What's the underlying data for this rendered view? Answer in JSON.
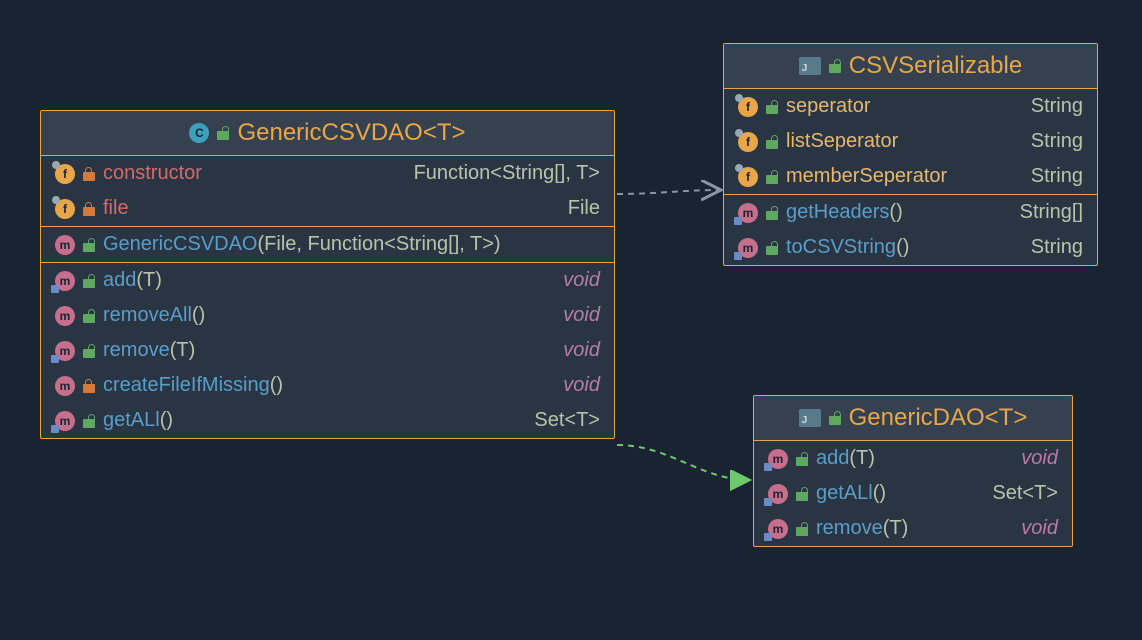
{
  "classes": {
    "generic_csv_dao": {
      "title": "GenericCSVDAO<T>",
      "fields": [
        {
          "icon": "f",
          "pin": true,
          "lock": "orange",
          "name": "constructor",
          "nameColor": "red",
          "type": "Function<String[], T>"
        },
        {
          "icon": "f",
          "pin": true,
          "lock": "orange",
          "name": "file",
          "nameColor": "red",
          "type": "File"
        }
      ],
      "constructors": [
        {
          "icon": "m",
          "lock": "green",
          "name": "GenericCSVDAO",
          "params": "(File, Function<String[], T>)"
        }
      ],
      "methods": [
        {
          "icon": "m",
          "lock": "green",
          "override": true,
          "name": "add",
          "params": "(T)",
          "ret": "void",
          "retStyle": "void"
        },
        {
          "icon": "m",
          "lock": "green",
          "name": "removeAll",
          "params": "()",
          "ret": "void",
          "retStyle": "void"
        },
        {
          "icon": "m",
          "lock": "green",
          "override": true,
          "name": "remove",
          "params": "(T)",
          "ret": "void",
          "retStyle": "void"
        },
        {
          "icon": "m",
          "lock": "orange",
          "name": "createFileIfMissing",
          "params": "()",
          "ret": "void",
          "retStyle": "void"
        },
        {
          "icon": "m",
          "lock": "green",
          "override": true,
          "name": "getALl",
          "params": "()",
          "ret": "Set<T>",
          "retStyle": "type"
        }
      ]
    },
    "csv_serializable": {
      "title": "CSVSerializable",
      "fields": [
        {
          "icon": "f",
          "pin": true,
          "lock": "green",
          "name": "seperator",
          "nameColor": "yellow",
          "type": "String"
        },
        {
          "icon": "f",
          "pin": true,
          "lock": "green",
          "name": "listSeperator",
          "nameColor": "yellow",
          "type": "String"
        },
        {
          "icon": "f",
          "pin": true,
          "lock": "green",
          "name": "memberSeperator",
          "nameColor": "yellow",
          "type": "String"
        }
      ],
      "methods": [
        {
          "icon": "m",
          "lock": "green",
          "override": true,
          "name": "getHeaders",
          "params": "()",
          "ret": "String[]",
          "retStyle": "type"
        },
        {
          "icon": "m",
          "lock": "green",
          "override": true,
          "name": "toCSVString",
          "params": "()",
          "ret": "String",
          "retStyle": "type"
        }
      ]
    },
    "generic_dao": {
      "title": "GenericDAO<T>",
      "methods": [
        {
          "icon": "m",
          "lock": "green",
          "override": true,
          "name": "add",
          "params": "(T)",
          "ret": "void",
          "retStyle": "void"
        },
        {
          "icon": "m",
          "lock": "green",
          "override": true,
          "name": "getALl",
          "params": "()",
          "ret": "Set<T>",
          "retStyle": "type"
        },
        {
          "icon": "m",
          "lock": "green",
          "override": true,
          "name": "remove",
          "params": "(T)",
          "ret": "void",
          "retStyle": "void"
        }
      ]
    }
  }
}
